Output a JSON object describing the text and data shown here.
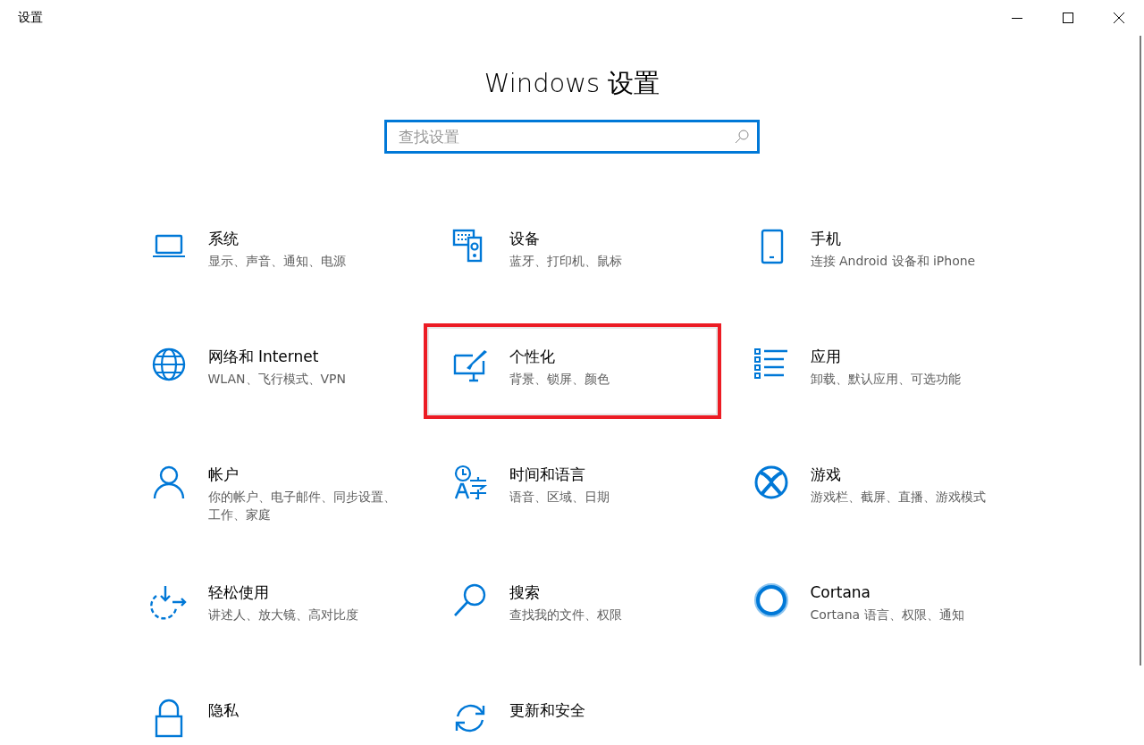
{
  "window": {
    "title": "设置"
  },
  "heading": "Windows 设置",
  "search": {
    "placeholder": "查找设置",
    "focused": true
  },
  "tiles": [
    {
      "kind": "laptop",
      "title": "系统",
      "subtitle": "显示、声音、通知、电源",
      "highlighted": false
    },
    {
      "kind": "keyboard",
      "title": "设备",
      "subtitle": "蓝牙、打印机、鼠标",
      "highlighted": false
    },
    {
      "kind": "phone",
      "title": "手机",
      "subtitle": "连接 Android 设备和 iPhone",
      "highlighted": false
    },
    {
      "kind": "globe",
      "title": "网络和 Internet",
      "subtitle": "WLAN、飞行模式、VPN",
      "highlighted": false
    },
    {
      "kind": "paint",
      "title": "个性化",
      "subtitle": "背景、锁屏、颜色",
      "highlighted": true
    },
    {
      "kind": "apps",
      "title": "应用",
      "subtitle": "卸载、默认应用、可选功能",
      "highlighted": false
    },
    {
      "kind": "person",
      "title": "帐户",
      "subtitle": "你的帐户、电子邮件、同步设置、工作、家庭",
      "highlighted": false
    },
    {
      "kind": "language",
      "title": "时间和语言",
      "subtitle": "语音、区域、日期",
      "highlighted": false
    },
    {
      "kind": "xbox",
      "title": "游戏",
      "subtitle": "游戏栏、截屏、直播、游戏模式",
      "highlighted": false
    },
    {
      "kind": "ease",
      "title": "轻松使用",
      "subtitle": "讲述人、放大镜、高对比度",
      "highlighted": false
    },
    {
      "kind": "search",
      "title": "搜索",
      "subtitle": "查找我的文件、权限",
      "highlighted": false
    },
    {
      "kind": "ring",
      "title": "Cortana",
      "subtitle": "Cortana 语言、权限、通知",
      "highlighted": false
    },
    {
      "kind": "lock",
      "title": "隐私",
      "highlighted": false
    },
    {
      "kind": "sync",
      "title": "更新和安全",
      "highlighted": false
    }
  ]
}
